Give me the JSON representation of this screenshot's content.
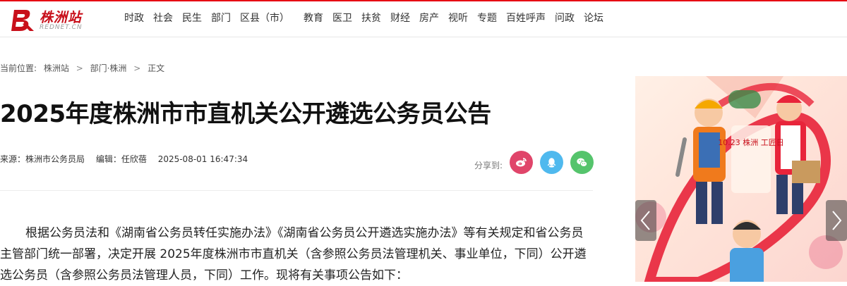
{
  "header": {
    "logo_text": "株洲站",
    "logo_sub": "REDNET.CN",
    "nav": [
      "时政",
      "社会",
      "民生",
      "部门",
      "区县（市）",
      "教育",
      "医卫",
      "扶贫",
      "财经",
      "房产",
      "视听",
      "专题",
      "百姓呼声",
      "问政",
      "论坛"
    ]
  },
  "breadcrumb": {
    "label": "当前位置:",
    "items": [
      "株洲站",
      "部门·株洲",
      "正文"
    ],
    "sep": ">"
  },
  "article": {
    "title": "2025年度株洲市市直机关公开遴选公务员公告",
    "source": "来源：株洲市公务员局",
    "editor": "编辑：任欣蓓",
    "time": "2025-08-01 16:47:34",
    "share_label": "分享到:",
    "body": "根据公务员法和《湖南省公务员转任实施办法》《湖南省公务员公开遴选实施办法》等有关规定和省公务员主管部门统一部署，决定开展 2025年度株洲市市直机关（含参照公务员法管理机关、事业单位，下同）公开遴选公务员（含参照公务员法管理人员，下同）工作。现将有关事项公告如下："
  },
  "share": {
    "weibo_color": "#e0456a",
    "qq_color": "#4fb9ee",
    "wechat_color": "#55c46c"
  },
  "banner": {
    "stamp_text": "10.23 株洲 工匠日"
  }
}
